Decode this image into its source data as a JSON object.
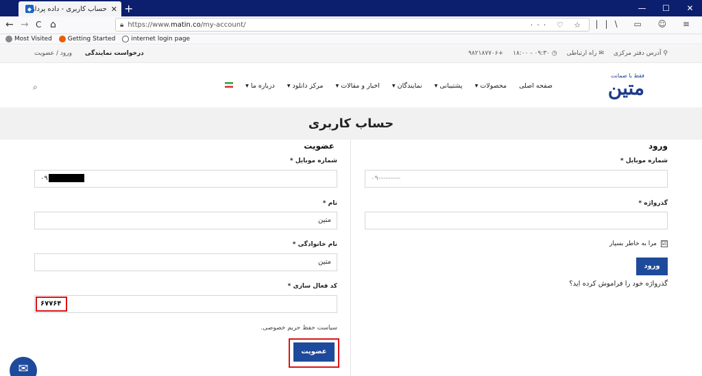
{
  "browser": {
    "tab_title": "حساب کاربری - داده پرداز رایانه ...",
    "tab_close": "✕",
    "new_tab": "+",
    "window_buttons": [
      "—",
      "☐",
      "✕"
    ],
    "url_prefix": "https://www.",
    "url_domain": "matin.co",
    "url_path": "/my-account/",
    "url_actions": "··· ♡ ☆",
    "nav_back": "←",
    "nav_forward": "→",
    "nav_reload": "C",
    "nav_home": "⌂",
    "nav_right_icons": "||\\ ▭ ☺ ≡",
    "bookmarks": [
      "Most Visited",
      "Getting Started",
      "internet login page"
    ]
  },
  "topbar": {
    "left_bold": "درخواست نمایندگی",
    "left_link": "ورود / عضویت",
    "address": "آدرس دفتر مرکزی",
    "contact": "راه ارتباطی",
    "hours": "۰۹:۳۰ - ۱۸:۰۰",
    "phone": "+۹۸۲۱۸۷۷۰۶"
  },
  "header": {
    "logo_tagline": "فقط با ضمانت",
    "logo_name": "متین",
    "menu": [
      "صفحه اصلی",
      "محصولات ▾",
      "پشتیبانی ▾",
      "نمایندگان ▾",
      "اخبار و مقالات ▾",
      "مرکز دانلود ▾",
      "درباره ما ▾"
    ],
    "search_icon": "⌕"
  },
  "page": {
    "title": "حساب کاربری"
  },
  "login": {
    "heading": "ورود",
    "mobile_label": "شماره موبایل *",
    "mobile_placeholder": "۰۹---------",
    "password_label": "گذرواژه *",
    "remember_label": "مرا به خاطر بسپار",
    "remember_checked": "☑",
    "submit": "ورود",
    "forgot": "گذرواژه خود را فراموش کرده اید؟"
  },
  "register": {
    "heading": "عضویت",
    "mobile_label": "شماره موبایل *",
    "mobile_value": "۰۹",
    "name_label": "نام *",
    "name_value": "متین",
    "family_label": "نام خانوادگی *",
    "family_value": "متین",
    "code_label": "کد فعال سازی *",
    "code_value": "۶۷۷۶۴",
    "privacy": "سیاست حفظ حریم خصوصی.",
    "submit": "عضویت"
  },
  "fab_icon": "✉",
  "colors": {
    "tabstrip": "#0b1f6e",
    "brand": "#1e4a9c",
    "highlight": "#dd1111"
  }
}
